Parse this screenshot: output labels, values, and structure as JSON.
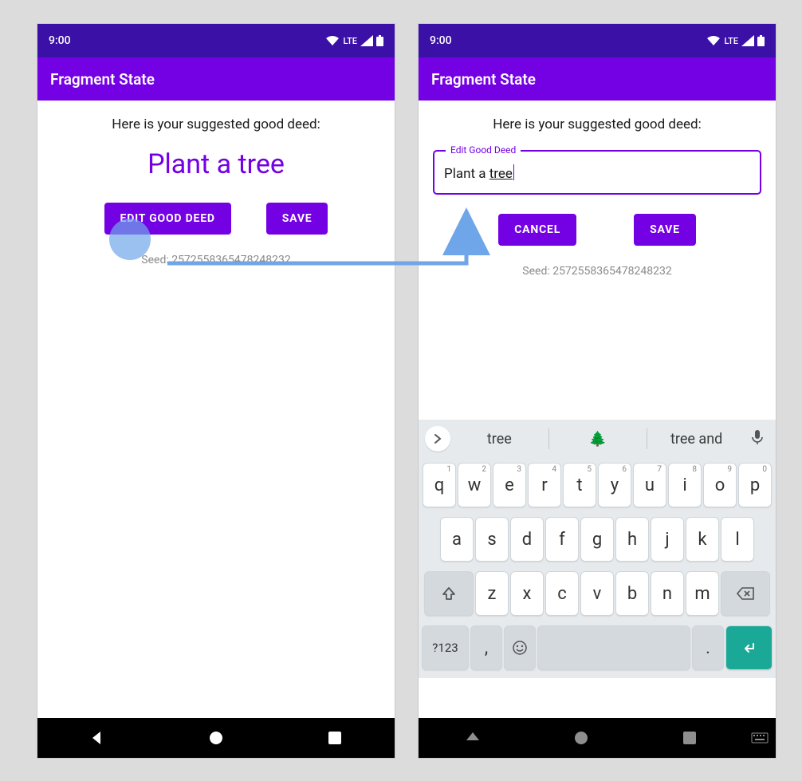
{
  "status": {
    "time": "9:00",
    "network": "LTE"
  },
  "appbar": {
    "title": "Fragment State"
  },
  "screen1": {
    "heading": "Here is your suggested good deed:",
    "deed": "Plant a tree",
    "buttons": {
      "edit": "EDIT GOOD DEED",
      "save": "SAVE"
    },
    "seed": "Seed: 2572558365478248232"
  },
  "screen2": {
    "heading": "Here is your suggested good deed:",
    "field": {
      "label": "Edit Good Deed",
      "prefix": "Plant a ",
      "underlined": "tree"
    },
    "buttons": {
      "cancel": "CANCEL",
      "save": "SAVE"
    },
    "seed": "Seed: 2572558365478248232"
  },
  "keyboard": {
    "suggestions": [
      "tree",
      "🌲",
      "tree and"
    ],
    "row1": [
      {
        "k": "q",
        "s": "1"
      },
      {
        "k": "w",
        "s": "2"
      },
      {
        "k": "e",
        "s": "3"
      },
      {
        "k": "r",
        "s": "4"
      },
      {
        "k": "t",
        "s": "5"
      },
      {
        "k": "y",
        "s": "6"
      },
      {
        "k": "u",
        "s": "7"
      },
      {
        "k": "i",
        "s": "8"
      },
      {
        "k": "o",
        "s": "9"
      },
      {
        "k": "p",
        "s": "0"
      }
    ],
    "row2": [
      "a",
      "s",
      "d",
      "f",
      "g",
      "h",
      "j",
      "k",
      "l"
    ],
    "row3": [
      "z",
      "x",
      "c",
      "v",
      "b",
      "n",
      "m"
    ],
    "bottom": {
      "symbols": "?123",
      "comma": ",",
      "period": "."
    }
  }
}
